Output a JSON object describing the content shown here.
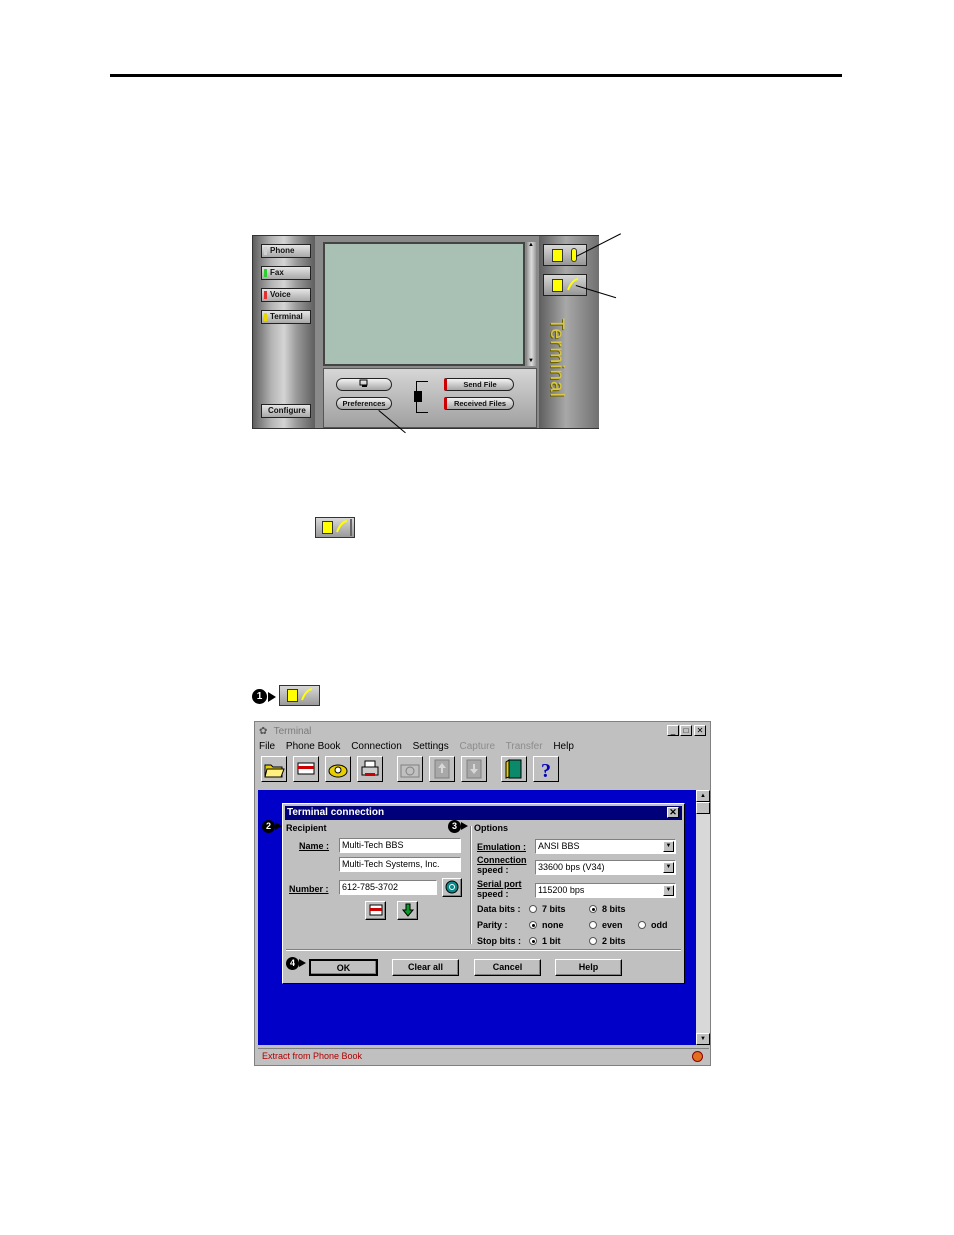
{
  "console": {
    "nav": [
      "Phone",
      "Fax",
      "Voice",
      "Terminal"
    ],
    "nav_colors": [
      "#d0d0d0",
      "#2ecc2e",
      "#e03030",
      "#e8d800"
    ],
    "configure_label": "Configure",
    "preferences_label": "Preferences",
    "send_file_label": "Send File",
    "received_files_label": "Received Files",
    "side_title": "Terminal"
  },
  "step_badges": [
    "1",
    "2",
    "3",
    "4"
  ],
  "terminal_window": {
    "title": "Terminal",
    "menu": [
      "File",
      "Phone Book",
      "Connection",
      "Settings",
      "Capture",
      "Transfer",
      "Help"
    ],
    "menu_disabled": [
      "Capture",
      "Transfer"
    ],
    "toolbar_icons": [
      "open-folder-icon",
      "phone-book-icon",
      "dial-phone-icon",
      "print-icon",
      "capture-camera-icon",
      "upload-icon",
      "download-icon",
      "exit-door-icon",
      "help-question-icon"
    ],
    "status_text": "Extract from Phone Book"
  },
  "dialog": {
    "title": "Terminal connection",
    "recipient_heading": "Recipient",
    "name_label": "Name :",
    "name_value": "Multi-Tech BBS",
    "company_value": "Multi-Tech Systems, Inc.",
    "number_label": "Number :",
    "number_value": "612-785-3702",
    "options_heading": "Options",
    "emulation_label": "Emulation :",
    "emulation_value": "ANSI BBS",
    "connection_speed_label_1": "Connection",
    "connection_speed_label_2": "speed :",
    "connection_speed_value": "33600 bps (V34)",
    "serial_speed_label_1": "Serial port",
    "serial_speed_label_2": "speed :",
    "serial_speed_value": "115200 bps",
    "data_bits_label": "Data bits :",
    "data_bits_options": [
      "7 bits",
      "8 bits"
    ],
    "data_bits_selected": "8 bits",
    "parity_label": "Parity :",
    "parity_options": [
      "none",
      "even",
      "odd"
    ],
    "parity_selected": "none",
    "stop_bits_label": "Stop bits :",
    "stop_bits_options": [
      "1 bit",
      "2 bits"
    ],
    "stop_bits_selected": "1 bit",
    "buttons": [
      "OK",
      "Clear all",
      "Cancel",
      "Help"
    ]
  },
  "colors": {
    "client_background": "#0000c8",
    "dialog_title_bar": "#00007b",
    "status_text": "#b00000",
    "screen": "#a9c1b4"
  }
}
